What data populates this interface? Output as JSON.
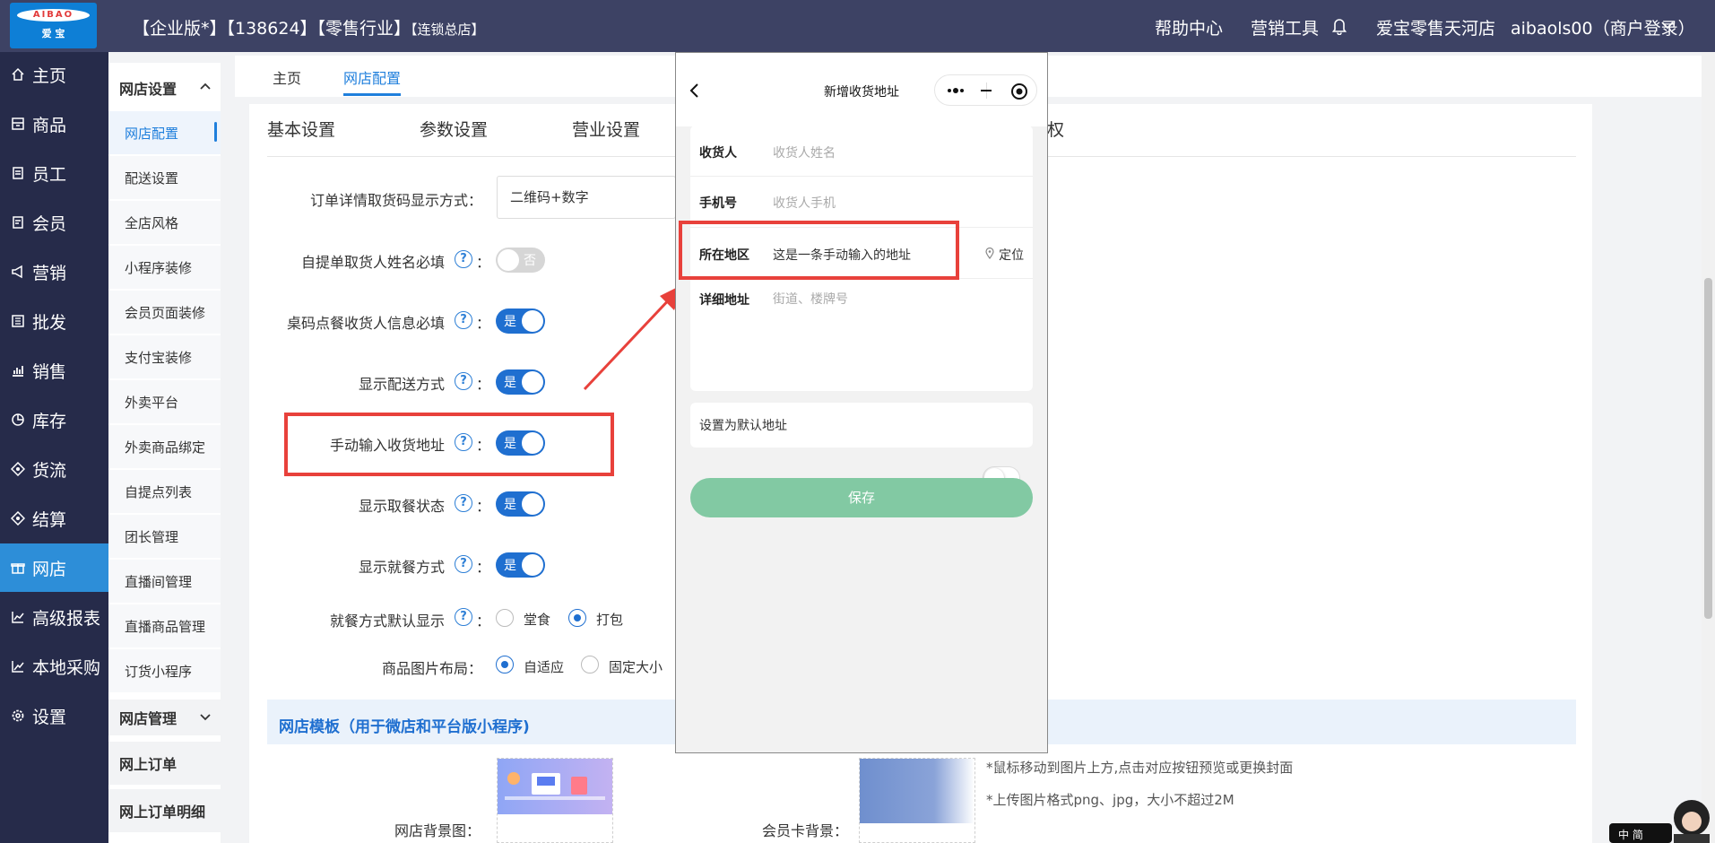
{
  "header": {
    "logo_text": "AIBAO",
    "logo_sub": "爱 宝",
    "title_main": "【企业版*】【138624】【零售行业】",
    "title_small": "【连锁总店】",
    "links": [
      "帮助中心",
      "营销工具"
    ],
    "store_name": "爱宝零售天河店",
    "user": "aibaols00（商户登录）",
    "icons": [
      "bell-icon",
      "chevron-down-icon"
    ]
  },
  "leftnav": {
    "items": [
      {
        "label": "主页",
        "icon": "home-icon"
      },
      {
        "label": "商品",
        "icon": "product-icon"
      },
      {
        "label": "员工",
        "icon": "staff-icon"
      },
      {
        "label": "会员",
        "icon": "member-icon"
      },
      {
        "label": "营销",
        "icon": "megaphone-icon"
      },
      {
        "label": "批发",
        "icon": "wholesale-icon"
      },
      {
        "label": "销售",
        "icon": "sales-chart-icon"
      },
      {
        "label": "库存",
        "icon": "pie-icon"
      },
      {
        "label": "货流",
        "icon": "flow-icon"
      },
      {
        "label": "结算",
        "icon": "settle-icon"
      },
      {
        "label": "网店",
        "icon": "gift-icon",
        "active": true
      },
      {
        "label": "高级报表",
        "icon": "line-chart-icon"
      },
      {
        "label": "本地采购",
        "icon": "trend-icon"
      },
      {
        "label": "设置",
        "icon": "gear-icon"
      }
    ]
  },
  "submenu": {
    "group1": "网店设置",
    "items": [
      "网店配置",
      "配送设置",
      "全店风格",
      "小程序装修",
      "会员页面装修",
      "支付宝装修",
      "外卖平台",
      "外卖商品绑定",
      "自提点列表",
      "团长管理",
      "直播间管理",
      "直播商品管理",
      "订货小程序"
    ],
    "active_index": 0,
    "group2": "网店管理",
    "links": [
      "网上订单",
      "网上订单明细"
    ]
  },
  "tabs": [
    "主页",
    "网店配置"
  ],
  "content_tabs": [
    "基本设置",
    "参数设置",
    "营业设置",
    "权"
  ],
  "settings": {
    "pickup_display_label": "订单详情取货码显示方式：",
    "pickup_display_value": "二维码+数字",
    "rows": [
      {
        "label": "自提单取货人姓名必填",
        "toggle": "否",
        "on": false
      },
      {
        "label": "桌码点餐收货人信息必填",
        "toggle": "是",
        "on": true
      },
      {
        "label": "显示配送方式",
        "toggle": "是",
        "on": true
      },
      {
        "label": "手动输入收货地址",
        "toggle": "是",
        "on": true
      },
      {
        "label": "显示取餐状态",
        "toggle": "是",
        "on": true
      },
      {
        "label": "显示就餐方式",
        "toggle": "是",
        "on": true
      }
    ],
    "colon": "：",
    "help": "?",
    "dining_label": "就餐方式默认显示",
    "dining_options": [
      "堂食",
      "打包"
    ],
    "layout_label": "商品图片布局：",
    "layout_options": [
      "自适应",
      "固定大小"
    ]
  },
  "template": {
    "title": "网店模板（用于微店和平台版小程序)",
    "bg_label": "网店背景图：",
    "card_label": "会员卡背景：",
    "notes": [
      "*鼠标移动到图片上方,点击对应按钮预览或更换封面",
      "*上传图片格式png、jpg，大小不超过2M"
    ]
  },
  "phone": {
    "title": "新增收货地址",
    "fields": [
      {
        "label": "收货人",
        "placeholder": "收货人姓名"
      },
      {
        "label": "手机号",
        "placeholder": "收货人手机"
      },
      {
        "label": "所在地区",
        "value": "这是一条手动输入的地址"
      },
      {
        "label": "详细地址",
        "placeholder": "街道、楼牌号"
      }
    ],
    "locate": "定位",
    "default_label": "设置为默认地址",
    "save": "保存"
  },
  "colors": {
    "topbar": "#3d4264",
    "leftnav": "#262b4a",
    "active_nav": "#2d8ed8",
    "accent": "#1f6fd0",
    "annotation": "#e8413b",
    "save_button": "#82c9a3"
  }
}
